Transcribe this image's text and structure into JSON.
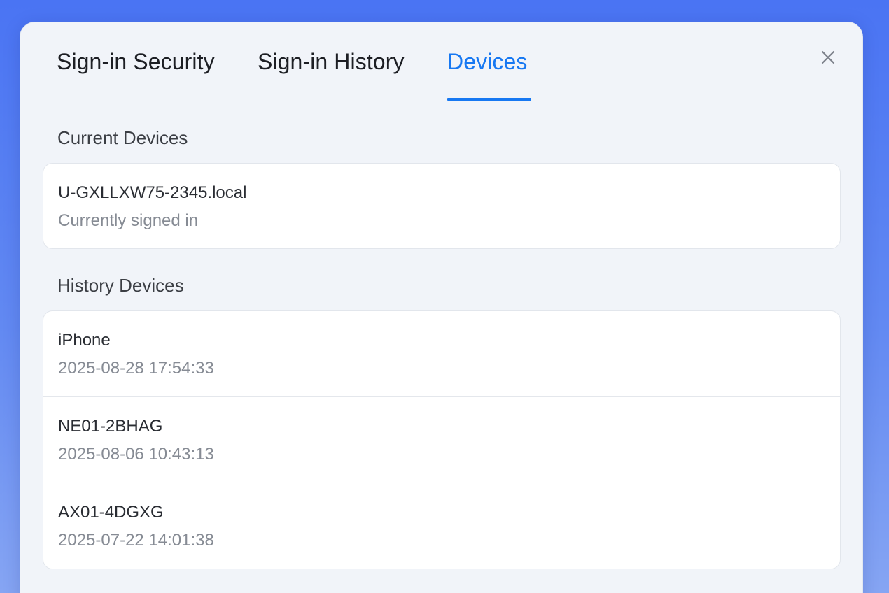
{
  "tabs": [
    {
      "label": "Sign-in Security",
      "active": false
    },
    {
      "label": "Sign-in History",
      "active": false
    },
    {
      "label": "Devices",
      "active": true
    }
  ],
  "close_icon": "close-icon",
  "current_section": {
    "title": "Current Devices",
    "devices": [
      {
        "name": "U-GXLLXW75-2345.local",
        "status": "Currently signed in"
      }
    ]
  },
  "history_section": {
    "title": "History Devices",
    "devices": [
      {
        "name": "iPhone",
        "last_seen": "2025-08-28 17:54:33"
      },
      {
        "name": "NE01-2BHAG",
        "last_seen": "2025-08-06 10:43:13"
      },
      {
        "name": "AX01-4DGXG",
        "last_seen": "2025-07-22 14:01:38"
      }
    ]
  },
  "colors": {
    "accent": "#1778f2",
    "panel_background": "#f1f4f9",
    "card_background": "#ffffff",
    "page_background_top": "#4a74f3"
  }
}
